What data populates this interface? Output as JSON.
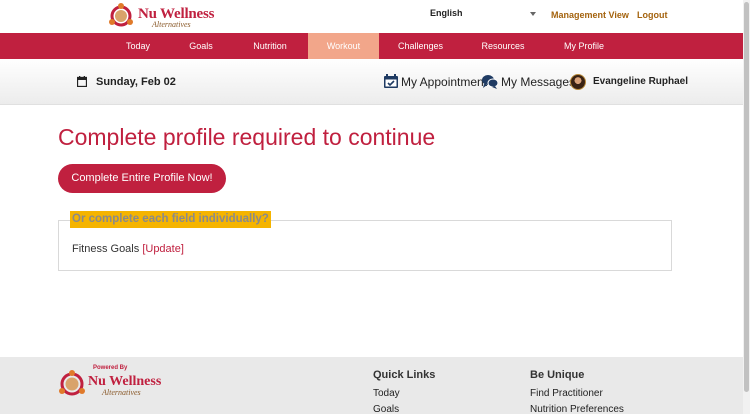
{
  "header": {
    "logo_text": "Nu Wellness",
    "logo_tagline": "Alternatives",
    "language": "English",
    "management_view": "Management View",
    "logout": "Logout"
  },
  "nav": {
    "items": [
      {
        "label": "Today"
      },
      {
        "label": "Goals"
      },
      {
        "label": "Nutrition"
      },
      {
        "label": "Workout",
        "active": true
      },
      {
        "label": "Challenges"
      },
      {
        "label": "Resources"
      },
      {
        "label": "My Profile"
      }
    ]
  },
  "subheader": {
    "date": "Sunday, Feb 02",
    "appointment": "My Appointment",
    "messages": "My Messages",
    "user_name": "Evangeline Ruphael"
  },
  "main": {
    "title": "Complete profile required to continue",
    "cta_label": "Complete Entire Profile Now!",
    "legend": "Or complete each field individually?",
    "field_label": "Fitness Goals",
    "update_link": "[Update]"
  },
  "footer": {
    "powered_by": "Powered By",
    "logo_text": "Nu Wellness",
    "logo_tagline": "Alternatives",
    "quick_links_heading": "Quick Links",
    "quick_links": [
      "Today",
      "Goals"
    ],
    "be_unique_heading": "Be Unique",
    "be_unique_links": [
      "Find Practitioner",
      "Nutrition Preferences"
    ]
  },
  "colors": {
    "brand": "#c0203f",
    "nav_active": "#f2a68a",
    "accent_gold": "#a4630e",
    "legend_highlight": "#f5b400"
  }
}
